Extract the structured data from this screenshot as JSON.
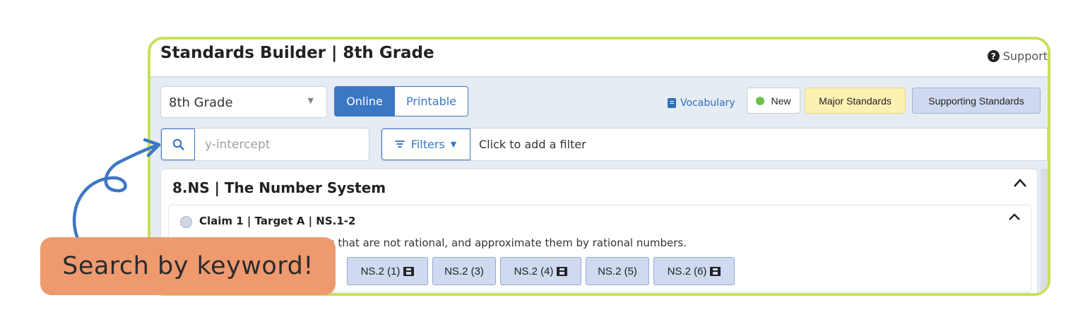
{
  "app": {
    "title": "Standards Builder | 8th Grade",
    "support_label": "Support"
  },
  "toolbar": {
    "grade_value": "8th Grade",
    "view_online": "Online",
    "view_printable": "Printable",
    "vocabulary_label": "Vocabulary",
    "legend_new": "New",
    "legend_major": "Major Standards",
    "legend_supporting": "Supporting Standards"
  },
  "search": {
    "placeholder": "y-intercept",
    "icon": "search-icon"
  },
  "filters": {
    "button_label": "Filters",
    "hint": "Click to add a filter"
  },
  "section": {
    "title": "8.NS | The Number System",
    "card": {
      "title": "Claim 1 | Target A | NS.1-2",
      "description": "Know that there are numbers that are not rational, and approximate them by rational numbers.",
      "chips": [
        {
          "label": "NS.2 (1)",
          "has_video": true
        },
        {
          "label": "NS.2 (3)",
          "has_video": false
        },
        {
          "label": "NS.2 (4)",
          "has_video": true
        },
        {
          "label": "NS.2 (5)",
          "has_video": false
        },
        {
          "label": "NS.2 (6)",
          "has_video": true
        }
      ]
    }
  },
  "callout": {
    "text": "Search by keyword!"
  },
  "colors": {
    "frame_border": "#c6e15a",
    "primary": "#3b78c4",
    "major": "#fdf0b3",
    "supporting": "#cfdaf0",
    "new_dot": "#6cc04a",
    "callout_bg": "#ee9a6e",
    "arrow": "#3e78c4"
  }
}
